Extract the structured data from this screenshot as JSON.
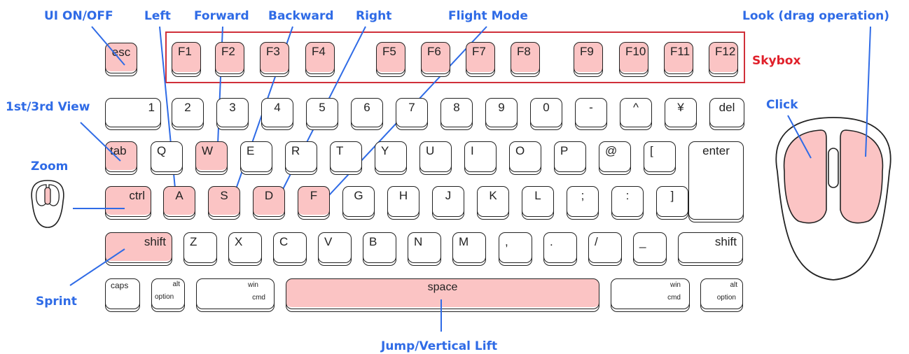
{
  "labels": {
    "ui_onoff": "UI ON/OFF",
    "left": "Left",
    "forward": "Forward",
    "backward": "Backward",
    "right": "Right",
    "flight_mode": "Flight Mode",
    "look": "Look (drag operation)",
    "skybox": "Skybox",
    "view": "1st/3rd View",
    "click": "Click",
    "zoom": "Zoom",
    "sprint": "Sprint",
    "jump": "Jump/Vertical Lift"
  },
  "keys": {
    "esc": "esc",
    "f": [
      "F1",
      "F2",
      "F3",
      "F4",
      "F5",
      "F6",
      "F7",
      "F8",
      "F9",
      "F10",
      "F11",
      "F12"
    ],
    "num": [
      "1",
      "2",
      "3",
      "4",
      "5",
      "6",
      "7",
      "8",
      "9",
      "0",
      "-",
      "^",
      "¥",
      "del"
    ],
    "tab": "tab",
    "qrow": [
      "Q",
      "W",
      "E",
      "R",
      "T",
      "Y",
      "U",
      "I",
      "O",
      "P",
      "@",
      "["
    ],
    "enter": "enter",
    "ctrl": "ctrl",
    "arow": [
      "A",
      "S",
      "D",
      "F",
      "G",
      "H",
      "J",
      "K",
      "L",
      ";",
      ":",
      "]"
    ],
    "shift_l": "shift",
    "zrow": [
      "Z",
      "X",
      "C",
      "V",
      "B",
      "N",
      "M",
      ",",
      ".",
      "/",
      "_"
    ],
    "shift_r": "shift",
    "caps": "caps",
    "alt": "alt",
    "option": "option",
    "win": "win",
    "cmd": "cmd",
    "space": "space"
  },
  "colors": {
    "annotation": "#2f6be6",
    "skybox": "#e0202a",
    "highlight": "#fbc4c4"
  }
}
